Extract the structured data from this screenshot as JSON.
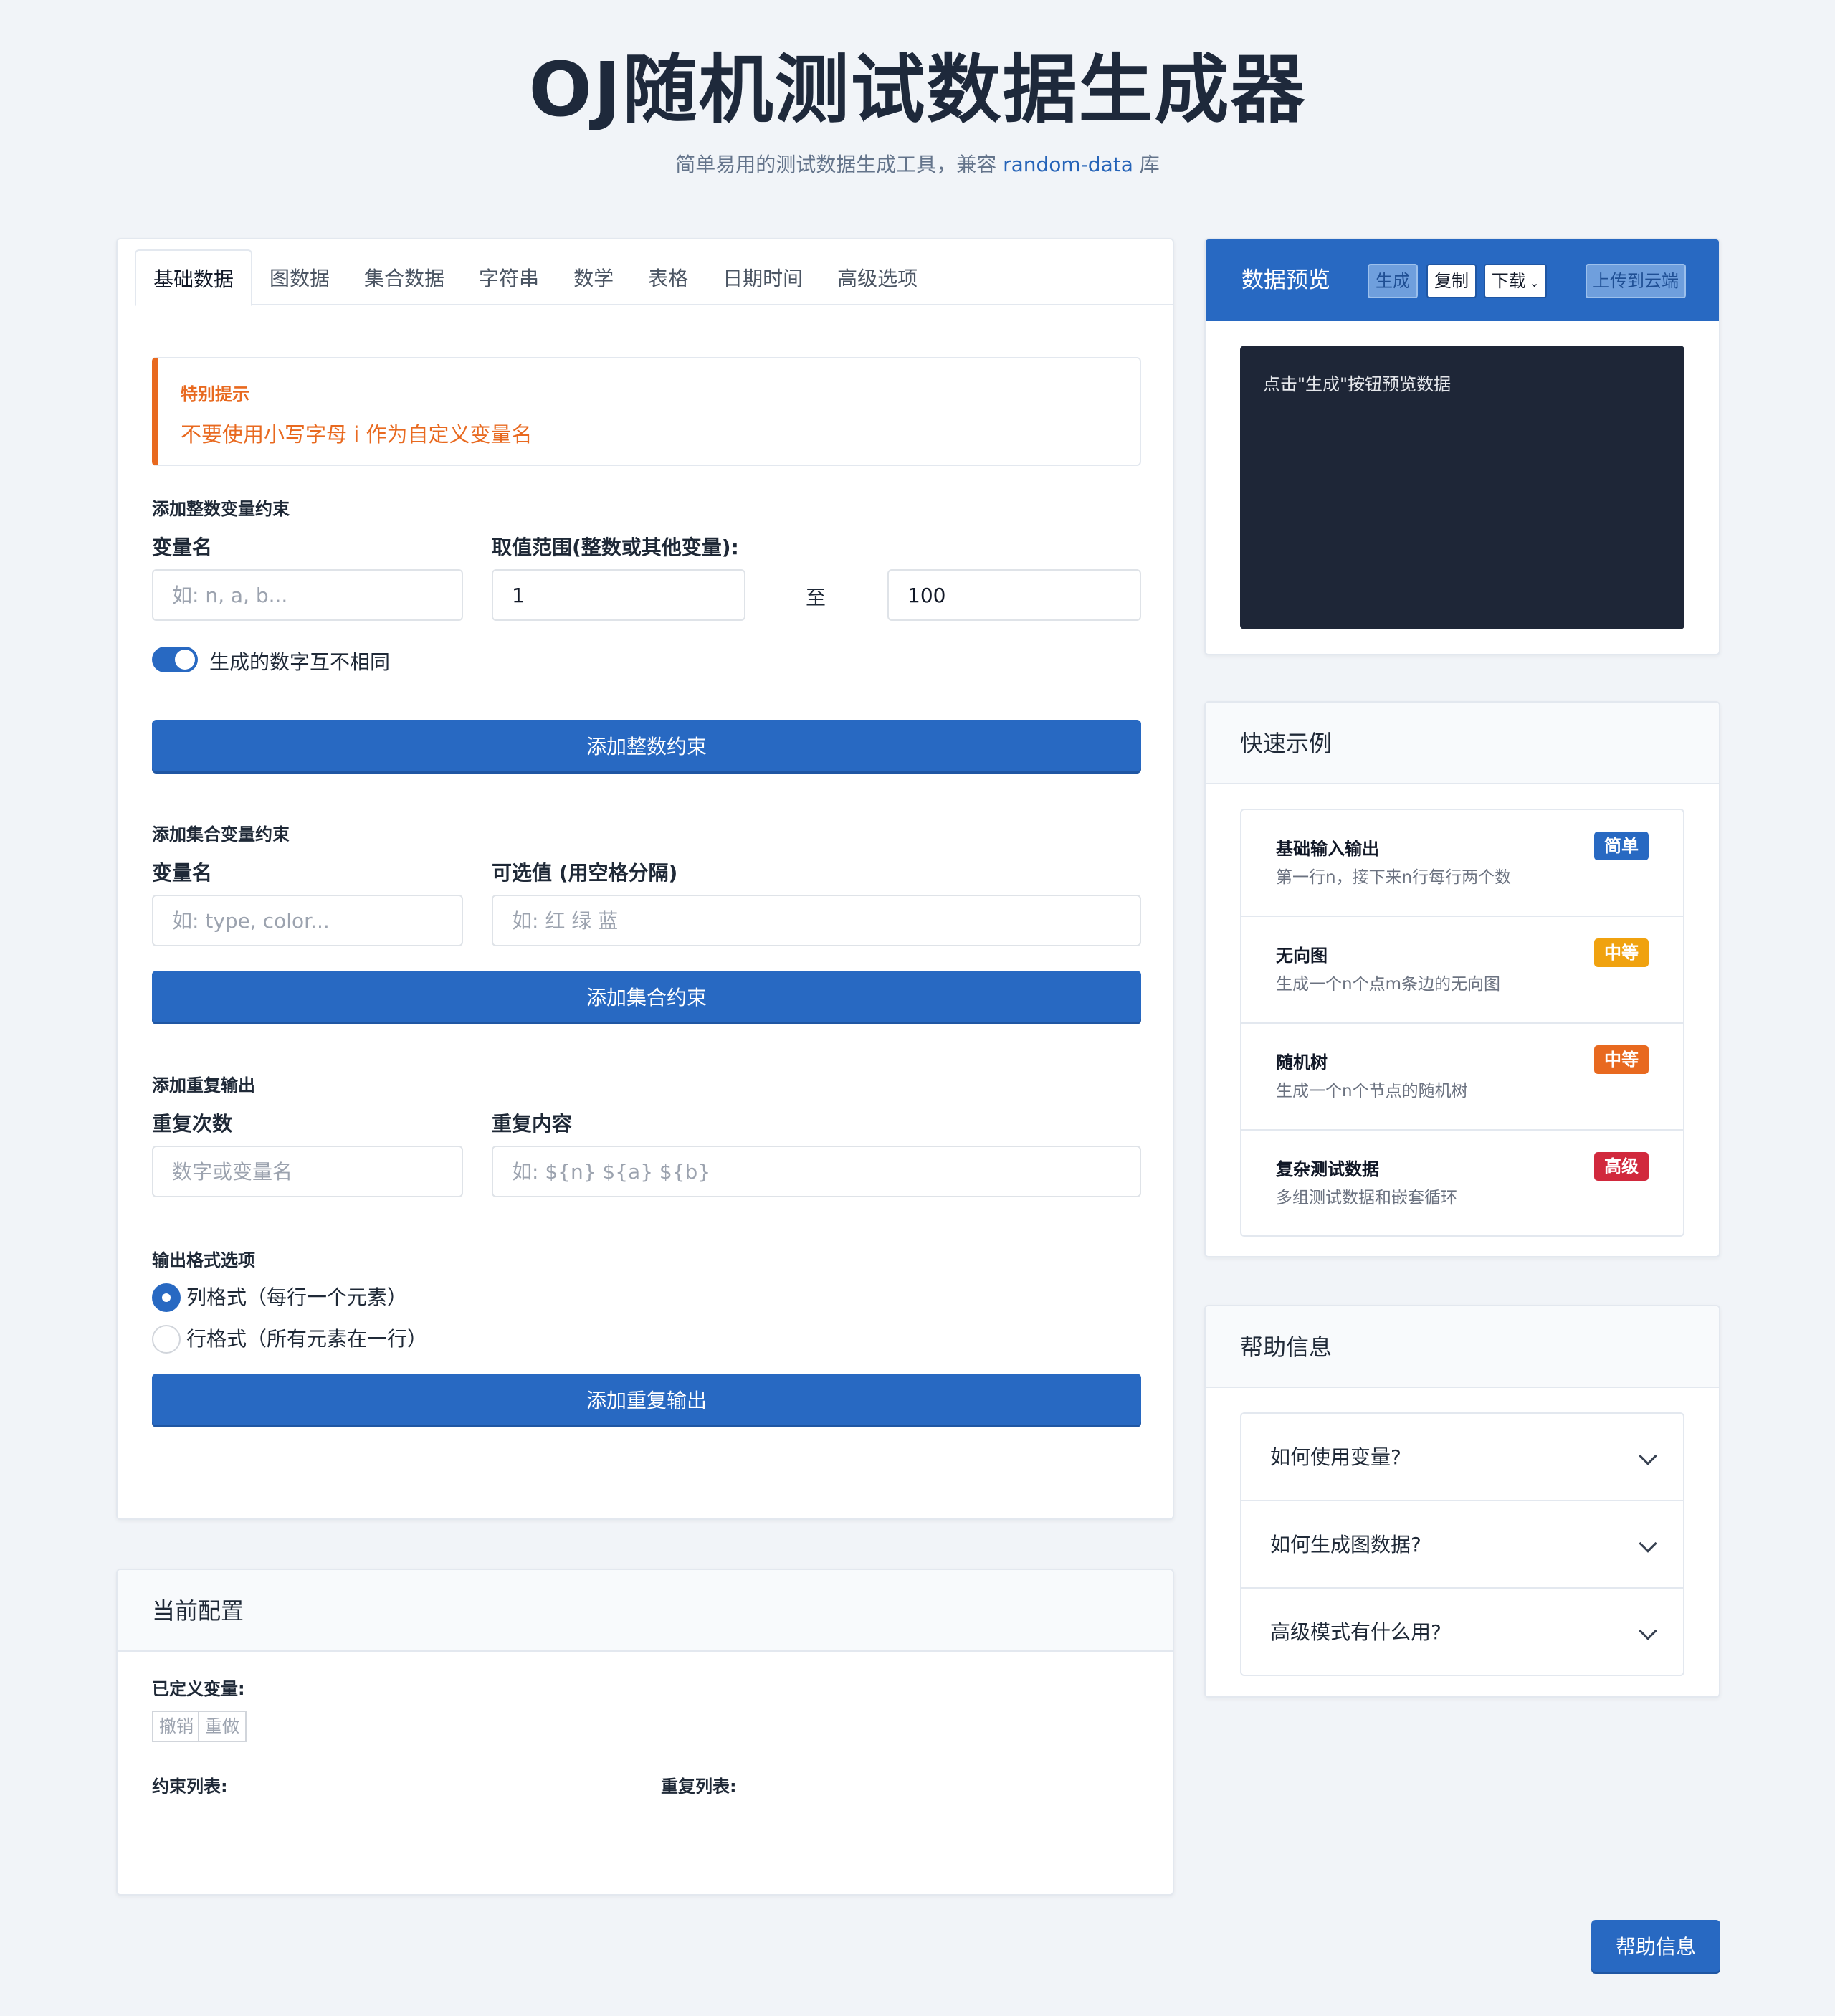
{
  "header": {
    "title": "OJ随机测试数据生成器",
    "subtitle_prefix": "简单易用的测试数据生成工具，兼容 ",
    "subtitle_link": "random-data",
    "subtitle_suffix": " 库"
  },
  "tabs": [
    "基础数据",
    "图数据",
    "集合数据",
    "字符串",
    "数学",
    "表格",
    "日期时间",
    "高级选项"
  ],
  "notice": {
    "title": "特别提示",
    "text": "不要使用小写字母 i 作为自定义变量名"
  },
  "int_section": {
    "title": "添加整数变量约束",
    "name_label": "变量名",
    "name_placeholder": "如: n, a, b...",
    "range_label": "取值范围(整数或其他变量):",
    "min_value": "1",
    "to_label": "至",
    "max_value": "100",
    "unique_label": "生成的数字互不相同",
    "unique_on": true,
    "button": "添加整数约束"
  },
  "set_section": {
    "title": "添加集合变量约束",
    "name_label": "变量名",
    "name_placeholder": "如: type, color...",
    "values_label": "可选值 (用空格分隔)",
    "values_placeholder": "如: 红 绿 蓝",
    "button": "添加集合约束"
  },
  "repeat_section": {
    "title": "添加重复输出",
    "count_label": "重复次数",
    "count_placeholder": "数字或变量名",
    "content_label": "重复内容",
    "content_placeholder": "如: ${n} ${a} ${b}",
    "format_title": "输出格式选项",
    "format_options": [
      "列格式（每行一个元素）",
      "行格式（所有元素在一行）"
    ],
    "format_selected": 0,
    "button": "添加重复输出"
  },
  "config": {
    "title": "当前配置",
    "defined_vars_label": "已定义变量:",
    "undo": "撤销",
    "redo": "重做",
    "constraints_label": "约束列表:",
    "repeats_label": "重复列表:"
  },
  "preview": {
    "title": "数据预览",
    "generate": "生成",
    "copy": "复制",
    "download": "下载",
    "upload": "上传到云端",
    "placeholder": "点击\"生成\"按钮预览数据"
  },
  "examples": {
    "title": "快速示例",
    "items": [
      {
        "title": "基础输入输出",
        "desc": "第一行n，接下来n行每行两个数",
        "badge": "简单",
        "color": "#2869c2"
      },
      {
        "title": "无向图",
        "desc": "生成一个n个点m条边的无向图",
        "badge": "中等",
        "color": "#f0a20f"
      },
      {
        "title": "随机树",
        "desc": "生成一个n个节点的随机树",
        "badge": "中等",
        "color": "#e8691f"
      },
      {
        "title": "复杂测试数据",
        "desc": "多组测试数据和嵌套循环",
        "badge": "高级",
        "color": "#d1293d"
      }
    ]
  },
  "help": {
    "title": "帮助信息",
    "items": [
      "如何使用变量?",
      "如何生成图数据?",
      "高级模式有什么用?"
    ],
    "floating_button": "帮助信息"
  },
  "colors": {
    "primary": "#2869c2",
    "warning": "#e8691f",
    "terminal_bg": "#1e2637"
  }
}
